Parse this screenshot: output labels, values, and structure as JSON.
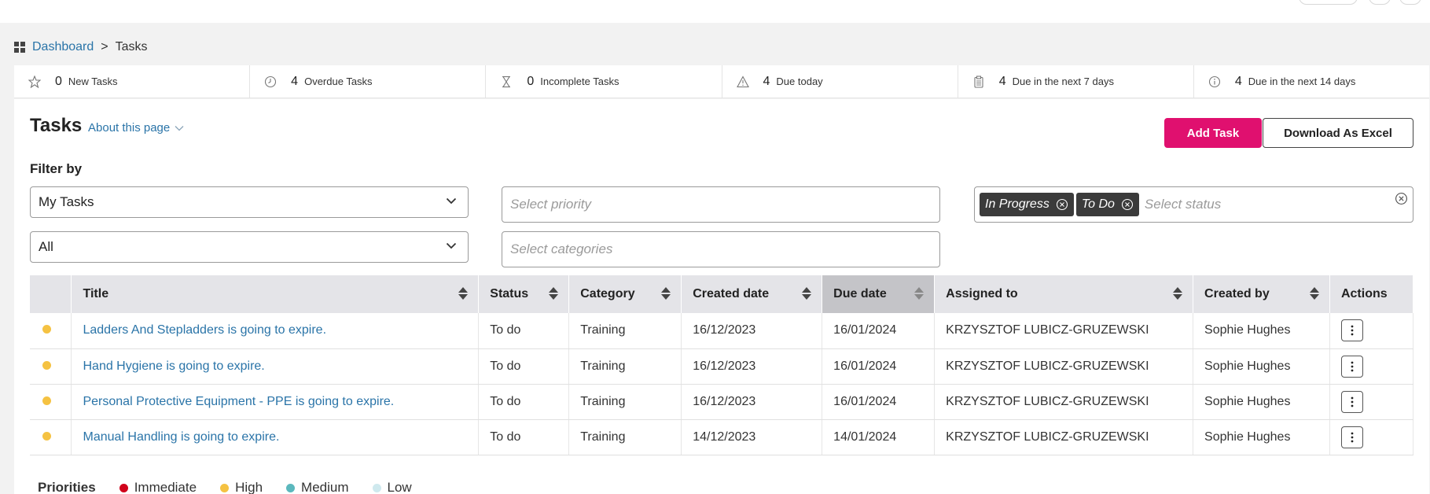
{
  "breadcrumb": {
    "home": "Dashboard",
    "separator": ">",
    "current": "Tasks"
  },
  "stats": [
    {
      "icon": "star-icon",
      "count": "0",
      "label": "New Tasks"
    },
    {
      "icon": "clock-icon",
      "count": "4",
      "label": "Overdue Tasks"
    },
    {
      "icon": "hourglass-icon",
      "count": "0",
      "label": "Incomplete Tasks"
    },
    {
      "icon": "warning-icon",
      "count": "4",
      "label": "Due today"
    },
    {
      "icon": "clipboard-icon",
      "count": "4",
      "label": "Due in the next 7 days"
    },
    {
      "icon": "info-icon",
      "count": "4",
      "label": "Due in the next 14 days"
    }
  ],
  "page": {
    "title": "Tasks",
    "about": "About this page",
    "add_button": "Add Task",
    "excel_button": "Download As Excel",
    "filter_label": "Filter by"
  },
  "filters": {
    "assignee": "My Tasks",
    "scope": "All",
    "priority_placeholder": "Select priority",
    "categories_placeholder": "Select categories",
    "status_tags": [
      "In Progress",
      "To Do"
    ],
    "status_placeholder": "Select status"
  },
  "table": {
    "headers": {
      "title": "Title",
      "status": "Status",
      "category": "Category",
      "created": "Created date",
      "due": "Due date",
      "assigned": "Assigned to",
      "created_by": "Created by",
      "actions": "Actions"
    },
    "rows": [
      {
        "priority_color": "#f5c242",
        "title": "Ladders And Stepladders is going to expire.",
        "status": "To do",
        "category": "Training",
        "created": "16/12/2023",
        "due": "16/01/2024",
        "assigned": "KRZYSZTOF LUBICZ-GRUZEWSKI",
        "created_by": "Sophie Hughes"
      },
      {
        "priority_color": "#f5c242",
        "title": "Hand Hygiene is going to expire.",
        "status": "To do",
        "category": "Training",
        "created": "16/12/2023",
        "due": "16/01/2024",
        "assigned": "KRZYSZTOF LUBICZ-GRUZEWSKI",
        "created_by": "Sophie Hughes"
      },
      {
        "priority_color": "#f5c242",
        "title": "Personal Protective Equipment - PPE is going to expire.",
        "status": "To do",
        "category": "Training",
        "created": "16/12/2023",
        "due": "16/01/2024",
        "assigned": "KRZYSZTOF LUBICZ-GRUZEWSKI",
        "created_by": "Sophie Hughes"
      },
      {
        "priority_color": "#f5c242",
        "title": "Manual Handling is going to expire.",
        "status": "To do",
        "category": "Training",
        "created": "14/12/2023",
        "due": "14/01/2024",
        "assigned": "KRZYSZTOF LUBICZ-GRUZEWSKI",
        "created_by": "Sophie Hughes"
      }
    ]
  },
  "legend": {
    "label": "Priorities",
    "items": [
      {
        "name": "Immediate",
        "color": "#d0021b"
      },
      {
        "name": "High",
        "color": "#f5c242"
      },
      {
        "name": "Medium",
        "color": "#5bb8bd"
      },
      {
        "name": "Low",
        "color": "#cfe9ee"
      }
    ]
  }
}
